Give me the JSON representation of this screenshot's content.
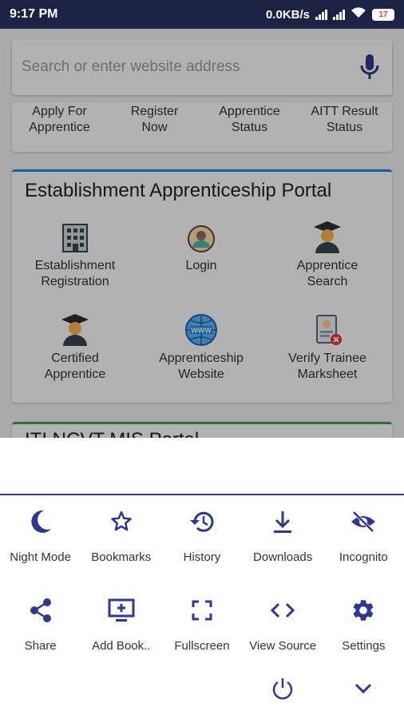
{
  "status_bar": {
    "time": "9:17 PM",
    "net_speed": "0.0KB/s",
    "battery": "17"
  },
  "browser": {
    "search_placeholder": "Search or enter website address"
  },
  "page": {
    "quick_links": [
      "Apply For\nApprentice",
      "Register\nNow",
      "Apprentice\nStatus",
      "AITT Result\nStatus"
    ],
    "portal_title": "Establishment Apprenticeship Portal",
    "portal_items": [
      {
        "label": "Establishment\nRegistration",
        "icon": "building-icon"
      },
      {
        "label": "Login",
        "icon": "user-circle-icon"
      },
      {
        "label": "Apprentice\nSearch",
        "icon": "graduate-icon"
      },
      {
        "label": "Certified\nApprentice",
        "icon": "graduate-icon"
      },
      {
        "label": "Apprenticeship\nWebsite",
        "icon": "globe-www-icon"
      },
      {
        "label": "Verify Trainee\nMarksheet",
        "icon": "id-card-icon"
      }
    ],
    "next_section_title": "ITI NCVT MIS Portal"
  },
  "menu": {
    "accent_color": "#2d3890",
    "row1": [
      {
        "label": "Night Mode",
        "icon": "moon-icon"
      },
      {
        "label": "Bookmarks",
        "icon": "star-icon"
      },
      {
        "label": "History",
        "icon": "history-icon"
      },
      {
        "label": "Downloads",
        "icon": "download-icon"
      },
      {
        "label": "Incognito",
        "icon": "eye-off-icon"
      }
    ],
    "row2": [
      {
        "label": "Share",
        "icon": "share-icon"
      },
      {
        "label": "Add Book..",
        "icon": "add-bookmark-icon"
      },
      {
        "label": "Fullscreen",
        "icon": "fullscreen-icon"
      },
      {
        "label": "View Source",
        "icon": "code-icon"
      },
      {
        "label": "Settings",
        "icon": "gear-icon"
      }
    ],
    "row3": [
      {
        "label": "",
        "icon": "power-icon"
      },
      {
        "label": "",
        "icon": "chevron-down-icon"
      }
    ]
  }
}
